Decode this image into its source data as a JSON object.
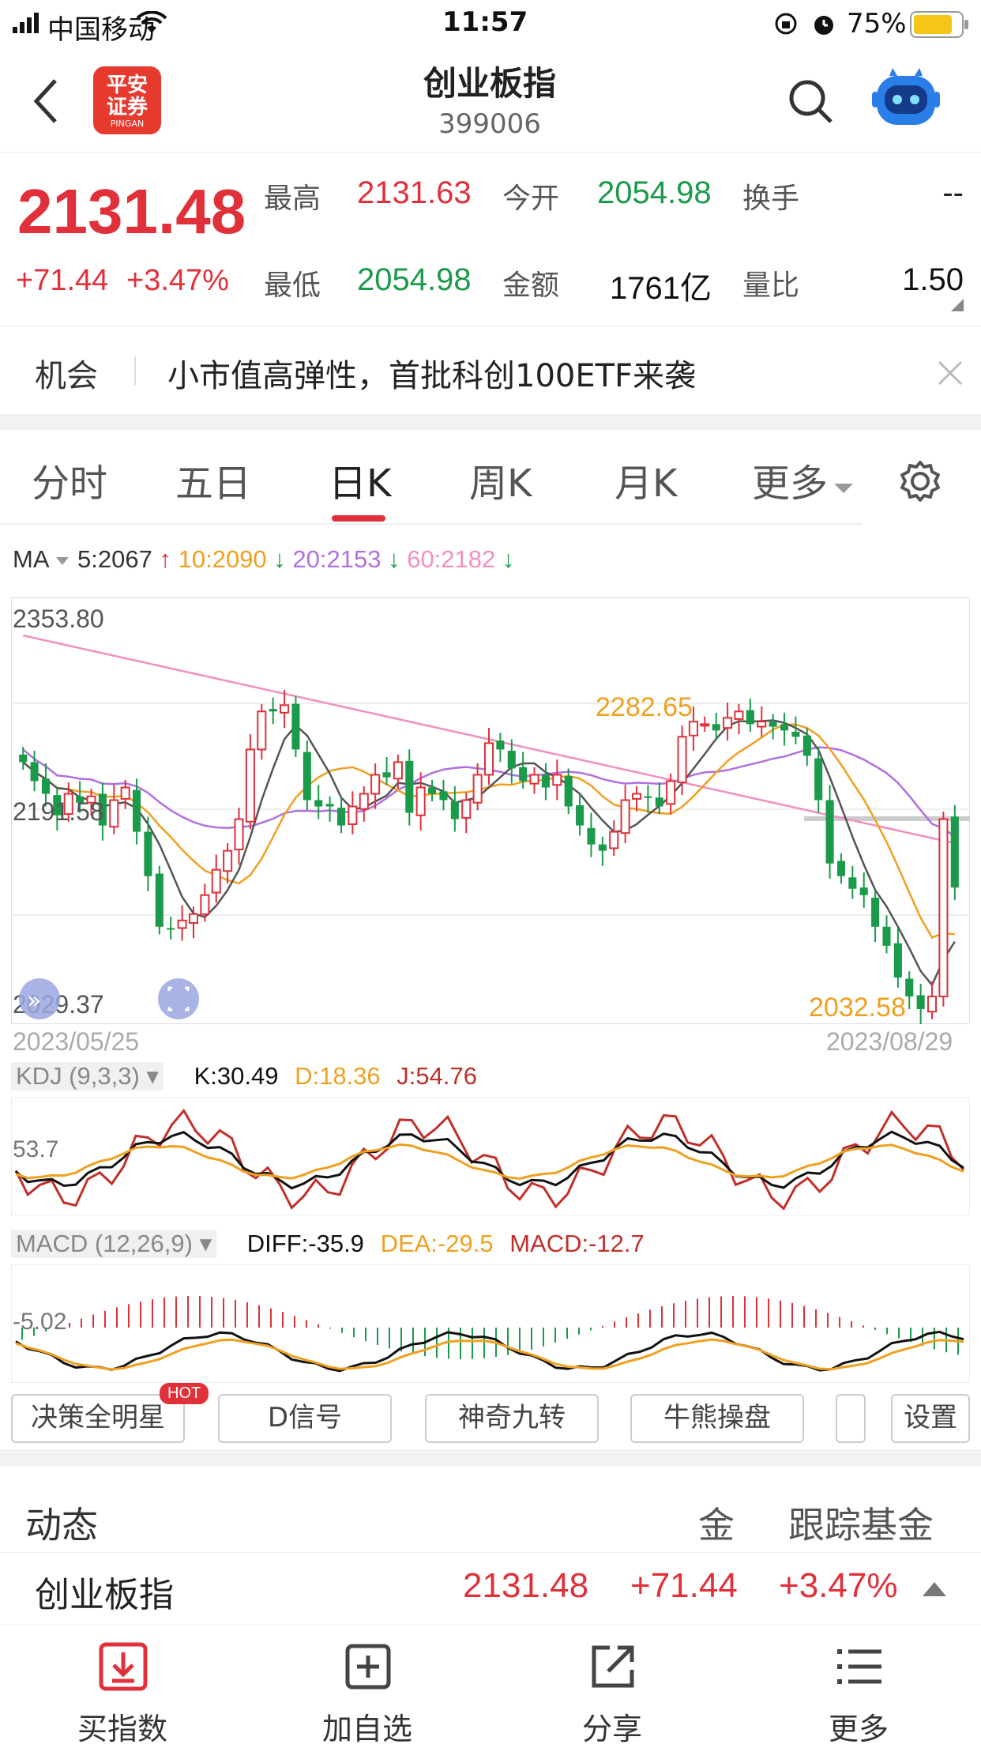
{
  "status": {
    "carrier": "中国移动",
    "time": "11:57",
    "battery": "75%",
    "icons": [
      "signal-icon",
      "wifi-icon",
      "lock-rotation-icon",
      "alarm-icon",
      "battery-icon"
    ]
  },
  "header": {
    "back_icon": "chevron-left-icon",
    "logo_text": "平安\n证券",
    "logo_sub": "PINGAN",
    "title": "创业板指",
    "code": "399006",
    "search_icon": "search-icon",
    "assistant_icon": "robot-icon"
  },
  "quote": {
    "price": "2131.48",
    "change": "+71.44",
    "change_pct": "+3.47%",
    "high_label": "最高",
    "high": "2131.63",
    "open_label": "今开",
    "open": "2054.98",
    "turnover_label": "换手",
    "turnover": "--",
    "low_label": "最低",
    "low": "2054.98",
    "amount_label": "金额",
    "amount": "1761亿",
    "ratio_label": "量比",
    "ratio": "1.50"
  },
  "banner": {
    "tag": "机会",
    "text": "小市值高弹性，首批科创100ETF来袭"
  },
  "tabs": [
    "分时",
    "五日",
    "日K",
    "周K",
    "月K",
    "更多"
  ],
  "active_tab": 2,
  "ma": {
    "label": "MA",
    "ma5": "5:2067",
    "ma10": "10:2090",
    "ma20": "20:2153",
    "ma60": "60:2182"
  },
  "colors": {
    "up": "#e0303a",
    "down": "#1a9a4a",
    "ma5": "#555555",
    "ma10": "#f0a020",
    "ma20": "#b070e0",
    "ma60": "#f090c0"
  },
  "chart_labels": {
    "y_top": "2353.80",
    "y_mid": "2191.58",
    "y_bot": "2029.37",
    "high_mark": "2282.65",
    "low_mark": "2032.58",
    "date_start": "2023/05/25",
    "date_end": "2023/08/29"
  },
  "kdj": {
    "label": "KDJ (9,3,3)",
    "k": "K:30.49",
    "d": "D:18.36",
    "j": "J:54.76",
    "level": "53.7"
  },
  "macd": {
    "label": "MACD (12,26,9)",
    "diff": "DIFF:-35.9",
    "dea": "DEA:-29.5",
    "macd": "MACD:-12.7",
    "level": "-5.02"
  },
  "indicator_buttons": [
    "决策全明星",
    "D信号",
    "神奇九转",
    "牛熊操盘",
    "",
    "设置"
  ],
  "hot_badge": "HOT",
  "section": {
    "tabs": [
      "动态",
      "金",
      "跟踪基金"
    ]
  },
  "bottom_row": {
    "name": "创业板指",
    "price": "2131.48",
    "change": "+71.44",
    "pct": "+3.47%"
  },
  "nav": [
    "买指数",
    "加自选",
    "分享",
    "更多"
  ],
  "chart_data": {
    "type": "candlestick",
    "ylim": [
      2029.37,
      2353.8
    ],
    "y_ticks": [
      "2353.80",
      "2191.58",
      "2029.37"
    ],
    "x_range": [
      "2023/05/25",
      "2023/08/29"
    ],
    "close_approx": [
      2230,
      2215,
      2205,
      2188,
      2205,
      2198,
      2203,
      2180,
      2200,
      2210,
      2175,
      2140,
      2100,
      2098,
      2105,
      2110,
      2125,
      2145,
      2160,
      2185,
      2240,
      2270,
      2270,
      2275,
      2240,
      2200,
      2195,
      2195,
      2180,
      2195,
      2205,
      2220,
      2218,
      2230,
      2190,
      2210,
      2205,
      2200,
      2185,
      2200,
      2220,
      2245,
      2240,
      2225,
      2215,
      2220,
      2210,
      2220,
      2195,
      2180,
      2165,
      2160,
      2175,
      2200,
      2205,
      2202,
      2195,
      2215,
      2250,
      2262,
      2260,
      2255,
      2265,
      2270,
      2260,
      2262,
      2258,
      2255,
      2250,
      2235,
      2200,
      2150,
      2140,
      2130,
      2125,
      2100,
      2085,
      2060,
      2045,
      2035,
      2045,
      2185,
      2131
    ],
    "series": [
      {
        "name": "5",
        "value": 2067
      },
      {
        "name": "10",
        "value": 2090
      },
      {
        "name": "20",
        "value": 2153
      },
      {
        "name": "60",
        "value": 2182
      }
    ]
  }
}
